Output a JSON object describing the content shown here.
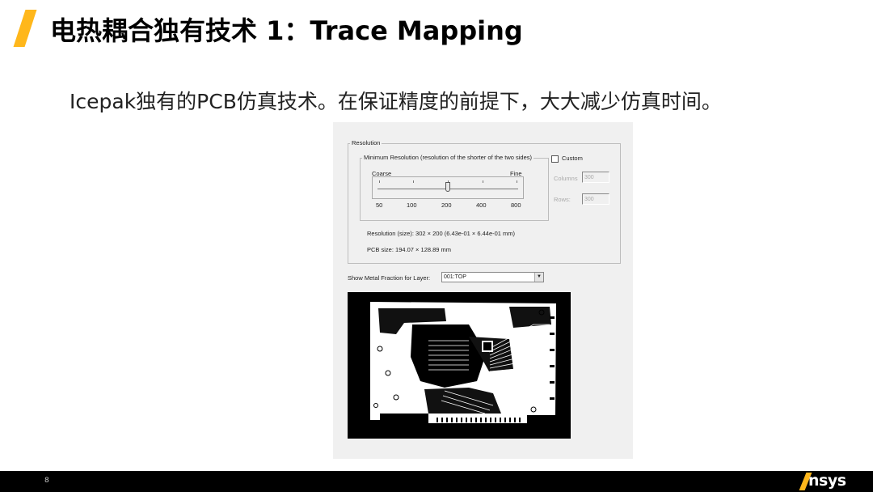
{
  "slide": {
    "title": "电热耦合独有技术 1：Trace Mapping",
    "subtitle": "Icepak独有的PCB仿真技术。在保证精度的前提下，大大减少仿真时间。",
    "page_number": "8",
    "brand": "nsys",
    "accent_color": "#FFB71B"
  },
  "dialog": {
    "resolution_group": "Resolution",
    "min_resolution_group": "Minimum Resolution (resolution of the shorter of the two sides)",
    "custom_label": "Custom",
    "custom_checked": false,
    "columns_label": "Columns",
    "columns_value": "300",
    "rows_label": "Rows:",
    "rows_value": "300",
    "slider": {
      "coarse_label": "Coarse",
      "fine_label": "Fine",
      "ticks": [
        "50",
        "100",
        "200",
        "400",
        "800"
      ],
      "selected": "200"
    },
    "resolution_size_label": "Resolution (size):",
    "resolution_size_value": "302 × 200 (6.43e-01 × 6.44e-01 mm)",
    "pcb_size_label": "PCB size:",
    "pcb_size_value": "194.07 × 128.89 mm",
    "metal_fraction_label": "Show Metal Fraction for Layer:",
    "layer_selected": "001:TOP"
  }
}
